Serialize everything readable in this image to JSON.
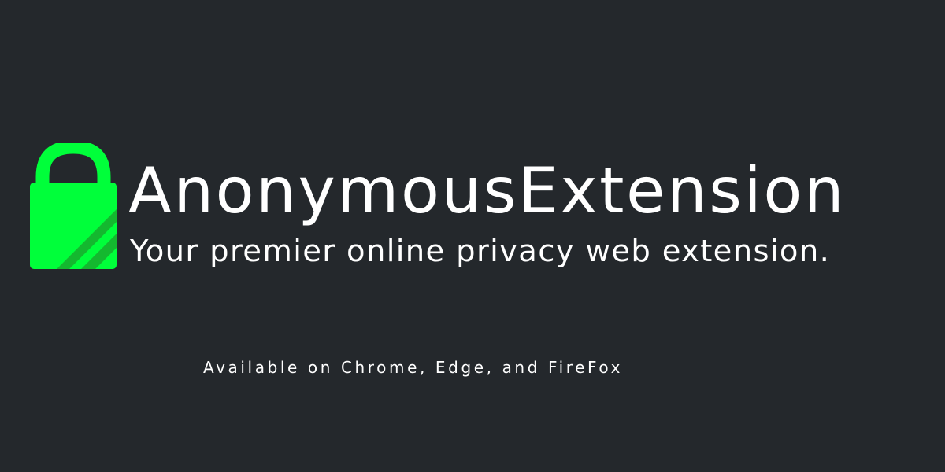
{
  "brand": {
    "logo_icon": "padlock-icon",
    "title": "AnonymousExtension",
    "tagline": "Your premier online privacy web extension."
  },
  "availability": {
    "text": "Available on Chrome, Edge, and FireFox"
  },
  "colors": {
    "background": "#24282c",
    "accent_green": "#00ff3a",
    "stripe_green": "#14b82f",
    "text": "#ffffff"
  }
}
